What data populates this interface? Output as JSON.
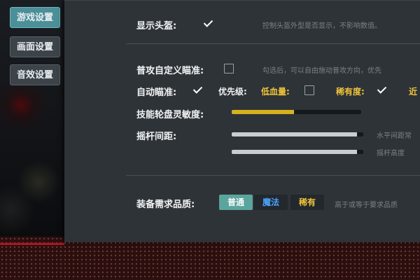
{
  "tabs": [
    {
      "label": "游戏设置",
      "active": true
    },
    {
      "label": "画面设置",
      "active": false
    },
    {
      "label": "音效设置",
      "active": false
    }
  ],
  "settings": {
    "show_head": {
      "label": "显示头盔:",
      "checked": true,
      "hint": "控制头盔外型是否显示，不影响数值。"
    },
    "custom_aim": {
      "label": "普攻自定义瞄准:",
      "checked": false,
      "hint": "勾选后，可以自由施动普攻方向，优先"
    },
    "auto_aim": {
      "label": "自动瞄准:",
      "checked": true
    },
    "priority": {
      "label": "优先级:",
      "low_hp": {
        "label": "低血量:",
        "checked": false
      },
      "rarity": {
        "label": "稀有度:",
        "checked": true
      },
      "near": {
        "label": "近"
      }
    },
    "skill_sensitivity": {
      "label": "技能轮盘灵敏度:",
      "value": 0.48
    },
    "joystick": {
      "label": "摇杆间距:",
      "horizontal": {
        "hint": "水平间距常",
        "value": 0.95
      },
      "height": {
        "hint": "摇杆高度",
        "value": 0.95
      }
    },
    "equip_quality": {
      "label": "装备需求品质:",
      "options": [
        "普通",
        "魔法",
        "稀有"
      ],
      "selected": "普通",
      "hint": "高于或等于要求品质"
    }
  },
  "colors": {
    "accent_teal": "#5aa59e",
    "gold": "#d8b21c",
    "magic_blue": "#4aa3ff",
    "rare_yellow": "#f0c53a"
  }
}
